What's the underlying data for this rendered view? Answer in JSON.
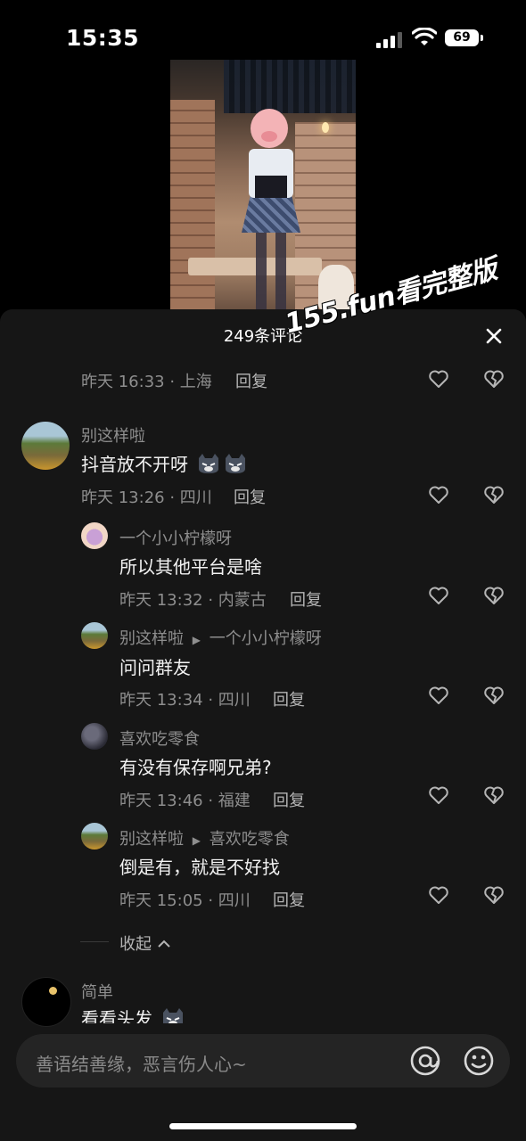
{
  "status_bar": {
    "time": "15:35",
    "battery": "69"
  },
  "panel": {
    "title": "249条评论",
    "watermark": "155.fun看完整版"
  },
  "top_row": {
    "meta": "昨天 16:33 · 上海",
    "reply": "回复"
  },
  "comments": [
    {
      "user": "别这样啦",
      "text": "抖音放不开呀",
      "meta": "昨天 13:26 · 四川",
      "reply": "回复"
    },
    {
      "user": "一个小小柠檬呀",
      "text": "所以其他平台是啥",
      "meta": "昨天 13:32 · 内蒙古",
      "reply": "回复"
    },
    {
      "user": "别这样啦",
      "reply_to": "一个小小柠檬呀",
      "text": "问问群友",
      "meta": "昨天 13:34 · 四川",
      "reply": "回复"
    },
    {
      "user": "喜欢吃零食",
      "text": "有没有保存啊兄弟?",
      "meta": "昨天 13:46 · 福建",
      "reply": "回复"
    },
    {
      "user": "别这样啦",
      "reply_to": "喜欢吃零食",
      "text": "倒是有，就是不好找",
      "meta": "昨天 15:05 · 四川",
      "reply": "回复"
    },
    {
      "user": "简单",
      "text": "看看头发"
    }
  ],
  "collapse_label": "收起",
  "input": {
    "placeholder": "善语结善缘，恶言伤人心~"
  },
  "icons": [
    "heart-icon",
    "broken-heart-icon",
    "close-icon",
    "at-icon",
    "emoji-icon",
    "cat-emoji-icon"
  ]
}
